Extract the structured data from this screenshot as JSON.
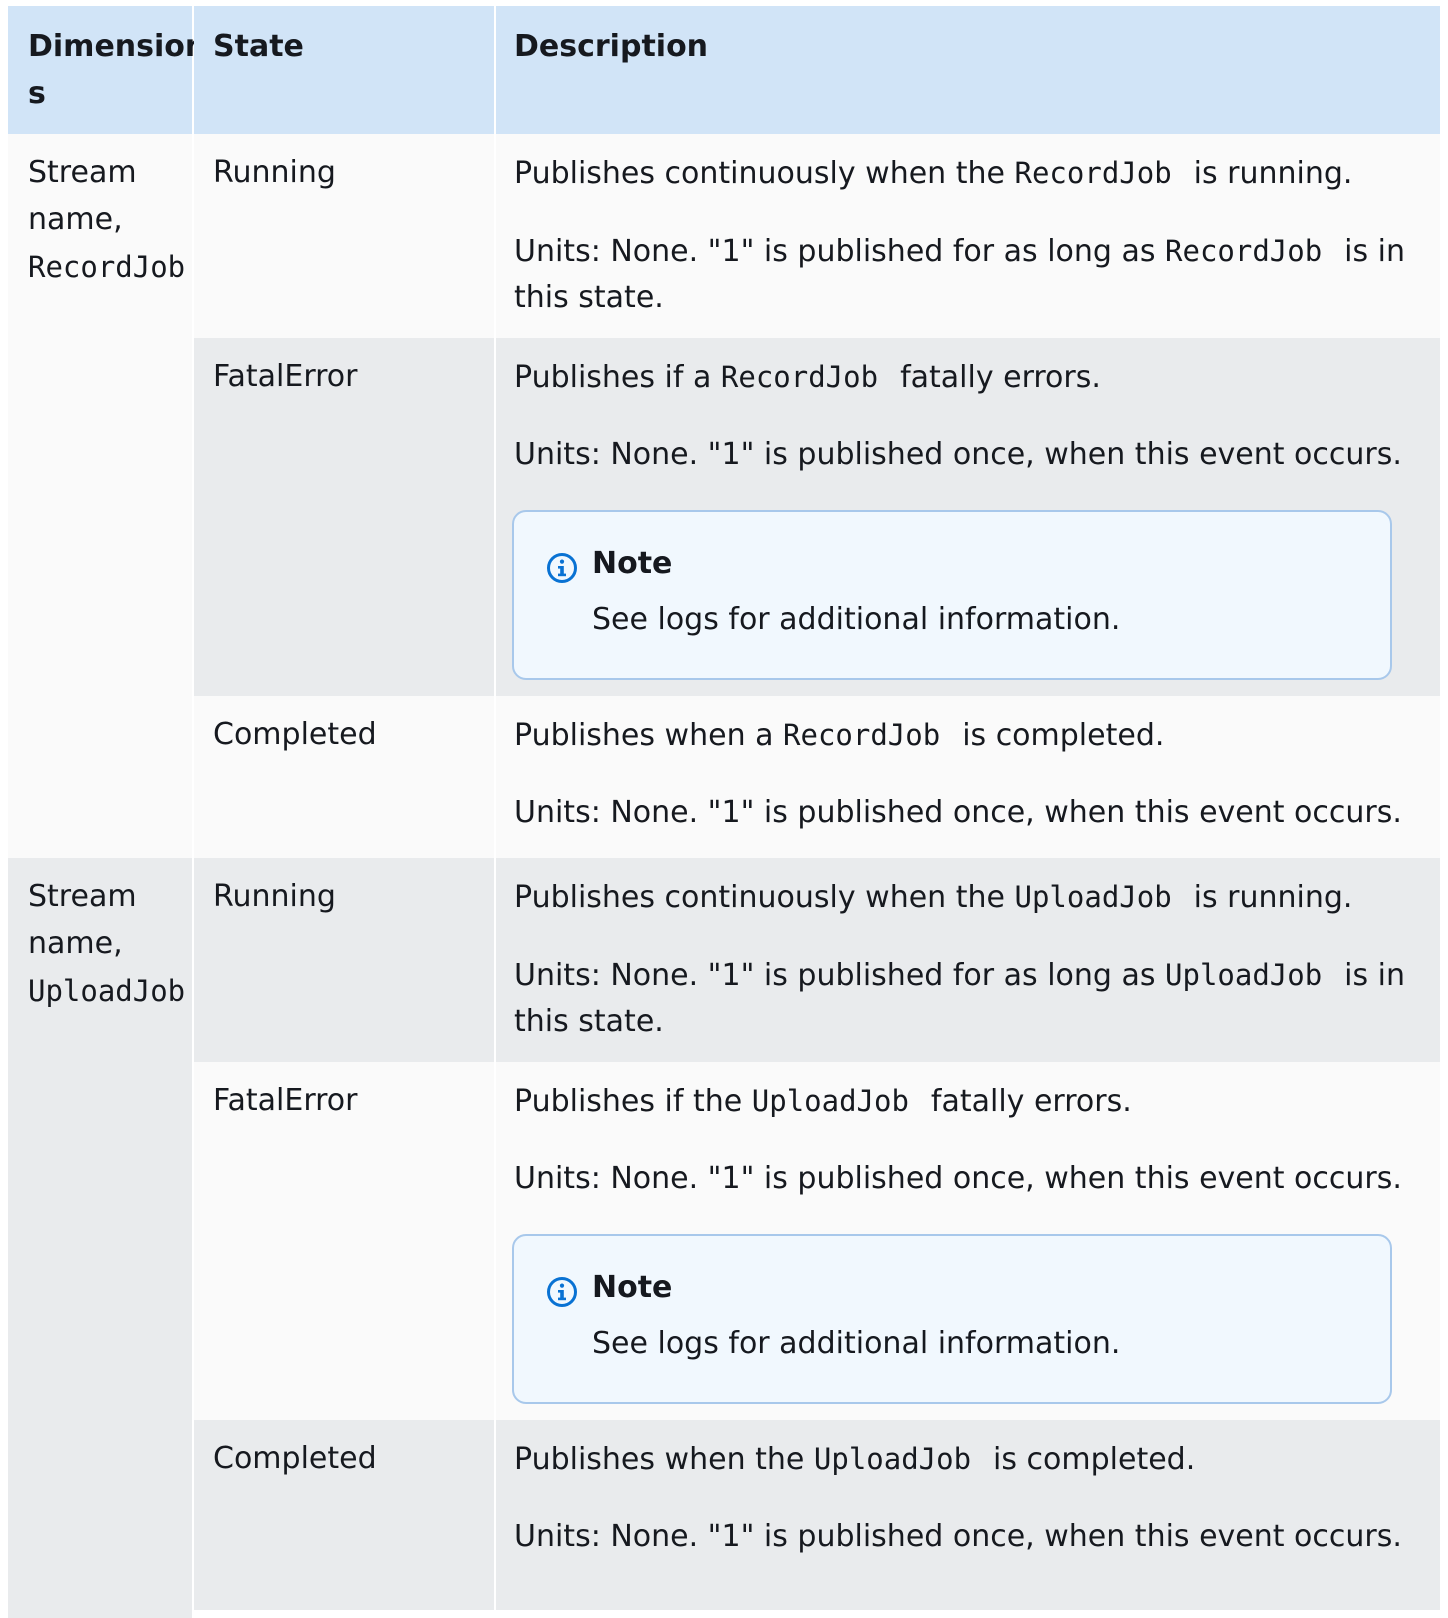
{
  "header": {
    "col_dimensions_line1": "Dimension",
    "col_dimensions_line2": "s",
    "col_state": "State",
    "col_description": "Description"
  },
  "groups": [
    {
      "dimension_line1": "Stream",
      "dimension_line2": "name,",
      "dimension_code": "RecordJob",
      "rows": [
        {
          "state": "Running",
          "desc_pre": "Publishes continuously when the",
          "desc_code": "RecordJob",
          "desc_post": "is running.",
          "units_pre": "Units: None. \"1\" is published for as long as",
          "units_code": "RecordJob",
          "units_post": "is in",
          "units_line2": "this state."
        },
        {
          "state": "FatalError",
          "desc_pre": "Publishes if a",
          "desc_code": "RecordJob",
          "desc_post": "fatally errors.",
          "units": "Units: None. \"1\" is published once, when this event occurs.",
          "note_title": "Note",
          "note_body": "See logs for additional information."
        },
        {
          "state": "Completed",
          "desc_pre": "Publishes when a",
          "desc_code": "RecordJob",
          "desc_post": "is completed.",
          "units": "Units: None. \"1\" is published once, when this event occurs."
        }
      ]
    },
    {
      "dimension_line1": "Stream",
      "dimension_line2": "name,",
      "dimension_code": "UploadJob",
      "rows": [
        {
          "state": "Running",
          "desc_pre": "Publishes continuously when the",
          "desc_code": "UploadJob",
          "desc_post": "is running.",
          "units_pre": "Units: None. \"1\" is published for as long as",
          "units_code": "UploadJob",
          "units_post": "is in",
          "units_line2": "this state."
        },
        {
          "state": "FatalError",
          "desc_pre": "Publishes if the",
          "desc_code": "UploadJob",
          "desc_post": "fatally errors.",
          "units": "Units: None. \"1\" is published once, when this event occurs.",
          "note_title": "Note",
          "note_body": "See logs for additional information."
        },
        {
          "state": "Completed",
          "desc_pre": "Publishes when the",
          "desc_code": "UploadJob",
          "desc_post": "is completed.",
          "units": "Units: None. \"1\" is published once, when this event occurs."
        }
      ]
    }
  ],
  "colors": {
    "header_bg": "#d1e4f7",
    "row_light": "#fafafa",
    "row_gray": "#e9ebed",
    "note_bg": "#f1f8fe",
    "note_border": "#a8c8eb",
    "info_icon": "#0972d3"
  },
  "icons": {
    "note_icon": "info-circle-icon"
  }
}
